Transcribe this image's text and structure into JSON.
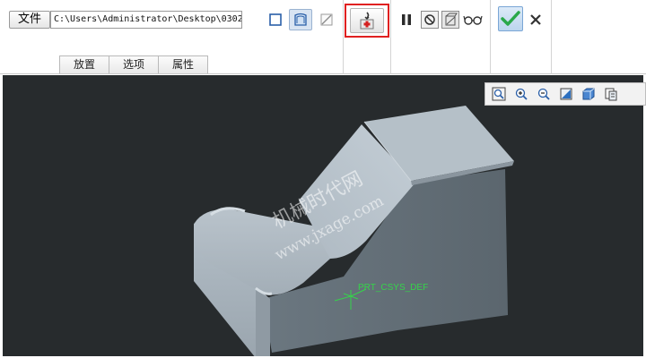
{
  "ribbon": {
    "file_label": "文件",
    "path_value": "C:\\Users\\Administrator\\Desktop\\0302",
    "tabs": [
      {
        "label": "放置"
      },
      {
        "label": "选项"
      },
      {
        "label": "属性"
      }
    ],
    "tools": {
      "surface_icon": "solid-cube-outline-icon",
      "thicken_icon": "surface-patch-icon",
      "flip_icon": "flip-direction-icon",
      "active_tool_icon": "insert-feature-icon",
      "pause_icon": "pause-icon",
      "no_preview_icon": "no-preview-icon",
      "preview_icon": "preview-icon",
      "glasses_icon": "glasses-icon",
      "ok_icon": "checkmark-icon",
      "cancel_icon": "close-icon"
    },
    "highlight_color": "#e02020",
    "ok_color": "#2aa84a"
  },
  "view_toolbar": {
    "icons": [
      "zoom-refit-icon",
      "zoom-in-icon",
      "zoom-out-icon",
      "repaint-icon",
      "display-style-icon",
      "saved-views-icon"
    ]
  },
  "viewport": {
    "background": "#272b2d",
    "model_color": "#a7b2bb",
    "csys_label": "PRT_CSYS_DEF"
  },
  "watermark": {
    "line1": "机械时代网",
    "line2": "www.jxage.com"
  }
}
